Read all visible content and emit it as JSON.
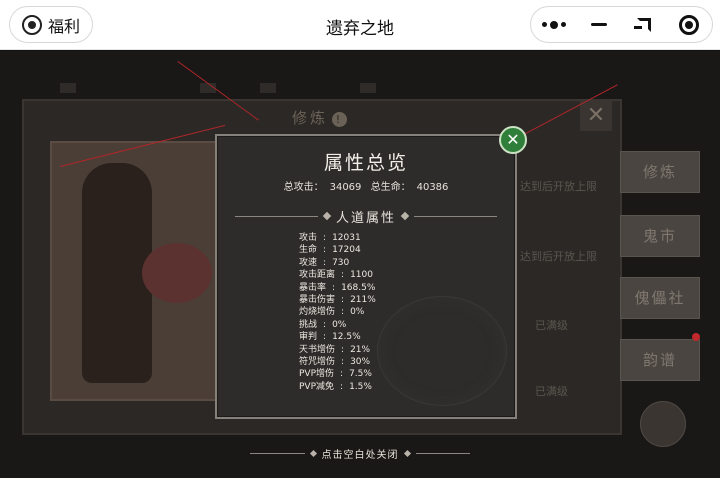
{
  "topbar": {
    "welfare_label": "福利",
    "title": "遗弃之地"
  },
  "background": {
    "cultivate_title": "修炼",
    "side_tabs": [
      "修炼",
      "鬼市",
      "傀儡社",
      "韵谱"
    ],
    "row_texts": [
      "达到后开放上限",
      "达到后开放上限",
      "已满级",
      "已满级"
    ]
  },
  "popup": {
    "title": "属性总览",
    "total_attack_label": "总攻击：",
    "total_attack": "34069",
    "total_hp_label": "总生命：",
    "total_hp": "40386",
    "section_label": "人道属性",
    "attributes": [
      {
        "name": "攻击",
        "value": "12031"
      },
      {
        "name": "生命",
        "value": "17204"
      },
      {
        "name": "攻速",
        "value": "730"
      },
      {
        "name": "攻击距离",
        "value": "1100"
      },
      {
        "name": "暴击率",
        "value": "168.5%"
      },
      {
        "name": "暴击伤害",
        "value": "211%"
      },
      {
        "name": "灼烧增伤",
        "value": "0%"
      },
      {
        "name": "挑战",
        "value": "0%"
      },
      {
        "name": "审判",
        "value": "12.5%"
      },
      {
        "name": "天书增伤",
        "value": "21%"
      },
      {
        "name": "符咒增伤",
        "value": "30%"
      },
      {
        "name": "PVP增伤",
        "value": "7.5%"
      },
      {
        "name": "PVP减免",
        "value": "1.5%"
      }
    ],
    "close_hint": "点击空白处关闭"
  },
  "colors": {
    "popup_bg": "#2e2c2b",
    "close_btn": "#2f7f3a",
    "red_lines": "#b0262a"
  }
}
